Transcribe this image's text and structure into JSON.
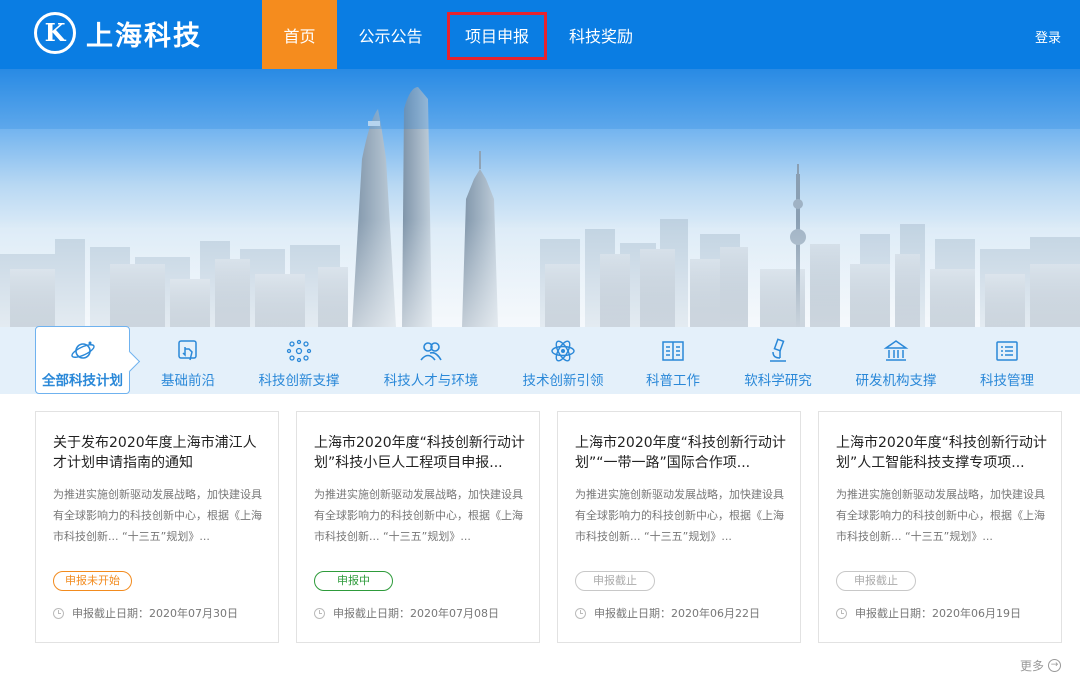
{
  "header": {
    "logo_mark": "K",
    "logo_text": "上海科技",
    "nav": [
      "首页",
      "公示公告",
      "项目申报",
      "科技奖励"
    ],
    "login": "登录",
    "colors": {
      "header_bg": "#0a7de3",
      "active_nav": "#f58c1e",
      "highlight_box": "#e8232e"
    }
  },
  "categories": [
    {
      "label": "全部科技计划",
      "icon": "planet-icon"
    },
    {
      "label": "基础前沿",
      "icon": "touch-icon"
    },
    {
      "label": "科技创新支撑",
      "icon": "network-icon"
    },
    {
      "label": "科技人才与环境",
      "icon": "people-icon"
    },
    {
      "label": "技术创新引领",
      "icon": "atom-icon"
    },
    {
      "label": "科普工作",
      "icon": "book-icon"
    },
    {
      "label": "软科学研究",
      "icon": "microscope-icon"
    },
    {
      "label": "研发机构支撑",
      "icon": "institution-icon"
    },
    {
      "label": "科技管理",
      "icon": "list-icon"
    }
  ],
  "cards": [
    {
      "title": "关于发布2020年度上海市浦江人才计划申请指南的通知",
      "desc": "为推进实施创新驱动发展战略，加快建设具有全球影响力的科技创新中心，根据《上海市科技创新... “十三五”规划》...",
      "status": "申报未开始",
      "deadline": "申报截止日期：2020年07月30日"
    },
    {
      "title": "上海市2020年度“科技创新行动计划”科技小巨人工程项目申报...",
      "desc": "为推进实施创新驱动发展战略，加快建设具有全球影响力的科技创新中心，根据《上海市科技创新... “十三五”规划》...",
      "status": "申报中",
      "deadline": "申报截止日期：2020年07月08日"
    },
    {
      "title": "上海市2020年度“科技创新行动计划”“一带一路”国际合作项...",
      "desc": "为推进实施创新驱动发展战略，加快建设具有全球影响力的科技创新中心，根据《上海市科技创新... “十三五”规划》...",
      "status": "申报截止",
      "deadline": "申报截止日期：2020年06月22日"
    },
    {
      "title": "上海市2020年度“科技创新行动计划”人工智能科技支撑专项项...",
      "desc": "为推进实施创新驱动发展战略，加快建设具有全球影响力的科技创新中心，根据《上海市科技创新... “十三五”规划》...",
      "status": "申报截止",
      "deadline": "申报截止日期：2020年06月19日"
    }
  ],
  "more": "更多"
}
